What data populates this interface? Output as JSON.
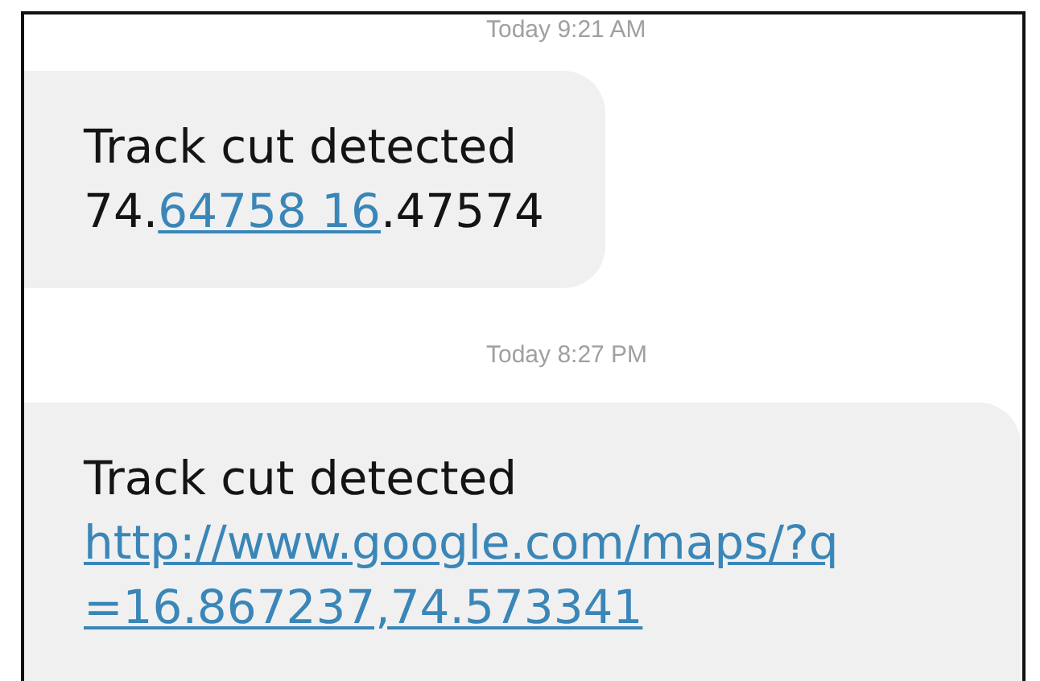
{
  "messages": [
    {
      "timestamp": "Today 9:21 AM",
      "wide": false,
      "lines": [
        [
          {
            "kind": "text",
            "text": "Track cut detected"
          }
        ],
        [
          {
            "kind": "text",
            "text": "74."
          },
          {
            "kind": "link",
            "text": "64758 16"
          },
          {
            "kind": "text",
            "text": ".47574"
          }
        ]
      ]
    },
    {
      "timestamp": "Today 8:27 PM",
      "wide": true,
      "lines": [
        [
          {
            "kind": "text",
            "text": "Track cut detected"
          }
        ],
        [
          {
            "kind": "link",
            "text": "http://www.google.com/maps/?q"
          }
        ],
        [
          {
            "kind": "link",
            "text": "=16.867237,74.573341"
          }
        ]
      ]
    }
  ]
}
